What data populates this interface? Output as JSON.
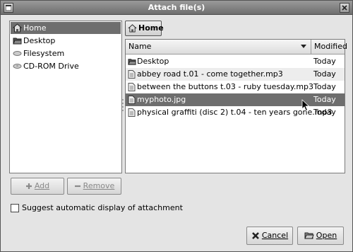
{
  "window": {
    "title": "Attach file(s)"
  },
  "places": {
    "items": [
      {
        "label": "Home",
        "icon": "home-icon",
        "selected": true
      },
      {
        "label": "Desktop",
        "icon": "desktop-icon",
        "selected": false
      },
      {
        "label": "Filesystem",
        "icon": "drive-icon",
        "selected": false
      },
      {
        "label": "CD-ROM Drive",
        "icon": "cdrom-icon",
        "selected": false
      }
    ],
    "add_label": "Add",
    "remove_label": "Remove"
  },
  "path": {
    "current": "Home"
  },
  "files": {
    "columns": {
      "name": "Name",
      "modified": "Modified"
    },
    "rows": [
      {
        "name": "Desktop",
        "modified": "Today",
        "icon": "folder-icon"
      },
      {
        "name": "abbey road t.01 - come together.mp3",
        "modified": "Today",
        "icon": "file-icon"
      },
      {
        "name": "between the buttons t.03 - ruby tuesday.mp3",
        "modified": "Today",
        "icon": "file-icon"
      },
      {
        "name": "myphoto.jpg",
        "modified": "Today",
        "icon": "file-icon",
        "selected": true
      },
      {
        "name": "physical graffiti (disc 2) t.04 - ten years gone.mp3",
        "modified": "Today",
        "icon": "file-icon"
      }
    ]
  },
  "options": {
    "suggest_label": "Suggest automatic display of attachment"
  },
  "buttons": {
    "cancel_label": "Cancel",
    "open_label": "Open"
  }
}
